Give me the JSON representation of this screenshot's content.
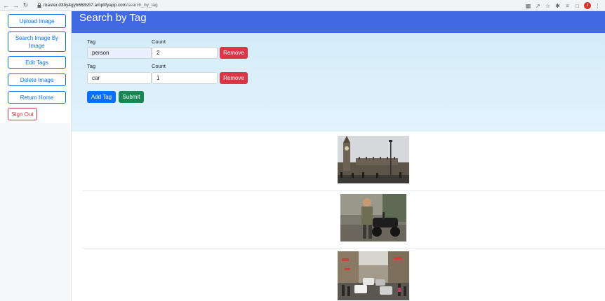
{
  "browser": {
    "url_host": "master.d3by4gyb668s57.amplifyapp.com",
    "url_path": "/search_by_tag",
    "avatar_letter": "J"
  },
  "sidebar": {
    "upload_label": "Upload Image",
    "search_image_label": "Search Image By Image",
    "edit_tags_label": "Edit Tags",
    "delete_label": "Delete Image",
    "return_home_label": "Return Home",
    "sign_out_label": "Sign Out"
  },
  "header": {
    "title": "Search by Tag"
  },
  "form": {
    "tag_label": "Tag",
    "count_label": "Count",
    "rows": [
      {
        "tag": "person",
        "count": "2",
        "remove_label": "Remove"
      },
      {
        "tag": "car",
        "count": "1",
        "remove_label": "Remove"
      }
    ],
    "add_tag_label": "Add Tag",
    "submit_label": "Submit"
  },
  "results": [
    {
      "image_name": "big-ben-photo"
    },
    {
      "image_name": "man-with-scooter-photo"
    },
    {
      "image_name": "busy-street-cars-photo"
    }
  ],
  "colors": {
    "header_bg": "#4169e1",
    "primary": "#0d6efd",
    "danger": "#dc3545",
    "success": "#198754"
  }
}
